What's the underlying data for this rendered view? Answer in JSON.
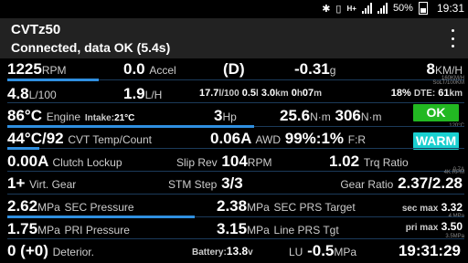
{
  "status_bar": {
    "net_label": "H+",
    "battery_percent": "50%",
    "time": "19:31"
  },
  "app_bar": {
    "title": "CVTz50",
    "subtitle": "Connected, data OK (5.4s)"
  },
  "rows": {
    "r1": {
      "rpm": "1225",
      "rpm_unit": "RPM",
      "accel": "0.0",
      "accel_label": "Accel",
      "gear": "(D)",
      "accel_g": "-0.31",
      "g_unit": "g",
      "speed": "8",
      "speed_unit": "KM/H"
    },
    "r2": {
      "fuel": "4.8",
      "fuel_unit": "L/100",
      "rate": "1.9",
      "rate_unit": "L/H",
      "trip_l100": "17.7",
      "trip_l100_unit": "l/100",
      "trip_l": "0.5",
      "trip_l_unit": "l",
      "trip_km": "3.0",
      "trip_km_unit": "km",
      "trip_h": "0",
      "trip_h_unit": "h",
      "trip_m": "07",
      "trip_m_unit": "m",
      "dte_pct": "18%",
      "dte_label": "DTE:",
      "dte_km": "61",
      "dte_unit": "km"
    },
    "r3": {
      "engine_temp": "86°C",
      "engine_label": "Engine",
      "intake_label": "Intake:",
      "intake_temp": "21°C",
      "hp": "3",
      "hp_unit": "Hp",
      "torque": "25.6",
      "torque_unit": "N·m",
      "torque_max": "306",
      "torque_max_unit": "N·m",
      "ok_label": "OK"
    },
    "r4": {
      "cvt_temp": "44°C/92",
      "cvt_label": "CVT Temp/Count",
      "awd_current": "0.06A",
      "awd_label": "AWD",
      "fr_pct": "99%:1%",
      "fr_label": "F:R",
      "warm_label": "WARM"
    },
    "r5": {
      "lockup_current": "0.00A",
      "lockup_label": "Clutch Lockup",
      "slip_label": "Slip Rev",
      "slip": "104",
      "slip_unit": "RPM",
      "trq_ratio": "1.02",
      "trq_label": "Trq Ratio"
    },
    "r6": {
      "virt_gear": "1+",
      "virt_label": "Virt. Gear",
      "stm_label": "STM Step",
      "stm": "3/3",
      "gear_ratio_label": "Gear Ratio",
      "gear_ratio": "2.37/2.28"
    },
    "r7": {
      "sec_pressure": "2.62",
      "sec_unit": "MPa",
      "sec_label": "SEC Pressure",
      "sec_target": "2.38",
      "sec_target_unit": "MPa",
      "sec_target_label": "SEC PRS Target",
      "sec_max_label": "sec max",
      "sec_max": "3.32"
    },
    "r8": {
      "pri_pressure": "1.75",
      "pri_unit": "MPa",
      "pri_label": "PRI Pressure",
      "line_tgt": "3.15",
      "line_unit": "MPa",
      "line_label": "Line PRS Tgt",
      "pri_max_label": "pri max",
      "pri_max": "3.50"
    },
    "r9": {
      "deterior": "0 (+0)",
      "deterior_label": "Deterior.",
      "battery_label": "Battery:",
      "battery_v": "13.8",
      "battery_unit": "v",
      "lu_label": "LU",
      "lu": "-0.5",
      "lu_unit": "MPa",
      "clock": "19:31:29"
    }
  },
  "scale_labels": {
    "speed_scale": "160KM/H",
    "dte_scale": "SoLT/100KM",
    "temp_scale": "120°C",
    "awd_scale": "0.7A",
    "slip_scale": "4K RPM",
    "sec_scale": "4 MPa",
    "pri_scale": "3.5MPa"
  },
  "gauges": {
    "rpm_fraction": 0.2,
    "temp_fraction": 0.54,
    "awd_fraction": 0.07,
    "sec_fraction": 0.41
  },
  "colors": {
    "ok": "#22b822",
    "warm": "#19d0d0",
    "gauge": "#2f8fe0"
  }
}
